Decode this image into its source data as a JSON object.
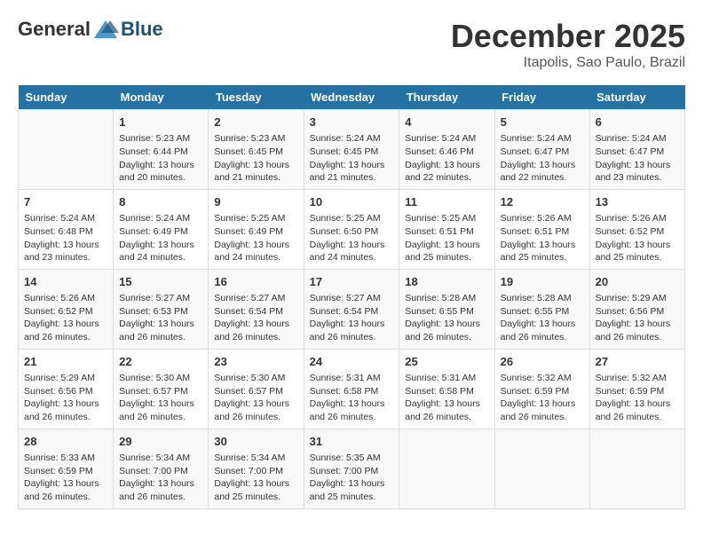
{
  "logo": {
    "general": "General",
    "blue": "Blue"
  },
  "title": "December 2025",
  "location": "Itapolis, Sao Paulo, Brazil",
  "days_header": [
    "Sunday",
    "Monday",
    "Tuesday",
    "Wednesday",
    "Thursday",
    "Friday",
    "Saturday"
  ],
  "weeks": [
    [
      {
        "day": "",
        "info": ""
      },
      {
        "day": "1",
        "info": "Sunrise: 5:23 AM\nSunset: 6:44 PM\nDaylight: 13 hours\nand 20 minutes."
      },
      {
        "day": "2",
        "info": "Sunrise: 5:23 AM\nSunset: 6:45 PM\nDaylight: 13 hours\nand 21 minutes."
      },
      {
        "day": "3",
        "info": "Sunrise: 5:24 AM\nSunset: 6:45 PM\nDaylight: 13 hours\nand 21 minutes."
      },
      {
        "day": "4",
        "info": "Sunrise: 5:24 AM\nSunset: 6:46 PM\nDaylight: 13 hours\nand 22 minutes."
      },
      {
        "day": "5",
        "info": "Sunrise: 5:24 AM\nSunset: 6:47 PM\nDaylight: 13 hours\nand 22 minutes."
      },
      {
        "day": "6",
        "info": "Sunrise: 5:24 AM\nSunset: 6:47 PM\nDaylight: 13 hours\nand 23 minutes."
      }
    ],
    [
      {
        "day": "7",
        "info": "Sunrise: 5:24 AM\nSunset: 6:48 PM\nDaylight: 13 hours\nand 23 minutes."
      },
      {
        "day": "8",
        "info": "Sunrise: 5:24 AM\nSunset: 6:49 PM\nDaylight: 13 hours\nand 24 minutes."
      },
      {
        "day": "9",
        "info": "Sunrise: 5:25 AM\nSunset: 6:49 PM\nDaylight: 13 hours\nand 24 minutes."
      },
      {
        "day": "10",
        "info": "Sunrise: 5:25 AM\nSunset: 6:50 PM\nDaylight: 13 hours\nand 24 minutes."
      },
      {
        "day": "11",
        "info": "Sunrise: 5:25 AM\nSunset: 6:51 PM\nDaylight: 13 hours\nand 25 minutes."
      },
      {
        "day": "12",
        "info": "Sunrise: 5:26 AM\nSunset: 6:51 PM\nDaylight: 13 hours\nand 25 minutes."
      },
      {
        "day": "13",
        "info": "Sunrise: 5:26 AM\nSunset: 6:52 PM\nDaylight: 13 hours\nand 25 minutes."
      }
    ],
    [
      {
        "day": "14",
        "info": "Sunrise: 5:26 AM\nSunset: 6:52 PM\nDaylight: 13 hours\nand 26 minutes."
      },
      {
        "day": "15",
        "info": "Sunrise: 5:27 AM\nSunset: 6:53 PM\nDaylight: 13 hours\nand 26 minutes."
      },
      {
        "day": "16",
        "info": "Sunrise: 5:27 AM\nSunset: 6:54 PM\nDaylight: 13 hours\nand 26 minutes."
      },
      {
        "day": "17",
        "info": "Sunrise: 5:27 AM\nSunset: 6:54 PM\nDaylight: 13 hours\nand 26 minutes."
      },
      {
        "day": "18",
        "info": "Sunrise: 5:28 AM\nSunset: 6:55 PM\nDaylight: 13 hours\nand 26 minutes."
      },
      {
        "day": "19",
        "info": "Sunrise: 5:28 AM\nSunset: 6:55 PM\nDaylight: 13 hours\nand 26 minutes."
      },
      {
        "day": "20",
        "info": "Sunrise: 5:29 AM\nSunset: 6:56 PM\nDaylight: 13 hours\nand 26 minutes."
      }
    ],
    [
      {
        "day": "21",
        "info": "Sunrise: 5:29 AM\nSunset: 6:56 PM\nDaylight: 13 hours\nand 26 minutes."
      },
      {
        "day": "22",
        "info": "Sunrise: 5:30 AM\nSunset: 6:57 PM\nDaylight: 13 hours\nand 26 minutes."
      },
      {
        "day": "23",
        "info": "Sunrise: 5:30 AM\nSunset: 6:57 PM\nDaylight: 13 hours\nand 26 minutes."
      },
      {
        "day": "24",
        "info": "Sunrise: 5:31 AM\nSunset: 6:58 PM\nDaylight: 13 hours\nand 26 minutes."
      },
      {
        "day": "25",
        "info": "Sunrise: 5:31 AM\nSunset: 6:58 PM\nDaylight: 13 hours\nand 26 minutes."
      },
      {
        "day": "26",
        "info": "Sunrise: 5:32 AM\nSunset: 6:59 PM\nDaylight: 13 hours\nand 26 minutes."
      },
      {
        "day": "27",
        "info": "Sunrise: 5:32 AM\nSunset: 6:59 PM\nDaylight: 13 hours\nand 26 minutes."
      }
    ],
    [
      {
        "day": "28",
        "info": "Sunrise: 5:33 AM\nSunset: 6:59 PM\nDaylight: 13 hours\nand 26 minutes."
      },
      {
        "day": "29",
        "info": "Sunrise: 5:34 AM\nSunset: 7:00 PM\nDaylight: 13 hours\nand 26 minutes."
      },
      {
        "day": "30",
        "info": "Sunrise: 5:34 AM\nSunset: 7:00 PM\nDaylight: 13 hours\nand 25 minutes."
      },
      {
        "day": "31",
        "info": "Sunrise: 5:35 AM\nSunset: 7:00 PM\nDaylight: 13 hours\nand 25 minutes."
      },
      {
        "day": "",
        "info": ""
      },
      {
        "day": "",
        "info": ""
      },
      {
        "day": "",
        "info": ""
      }
    ]
  ]
}
